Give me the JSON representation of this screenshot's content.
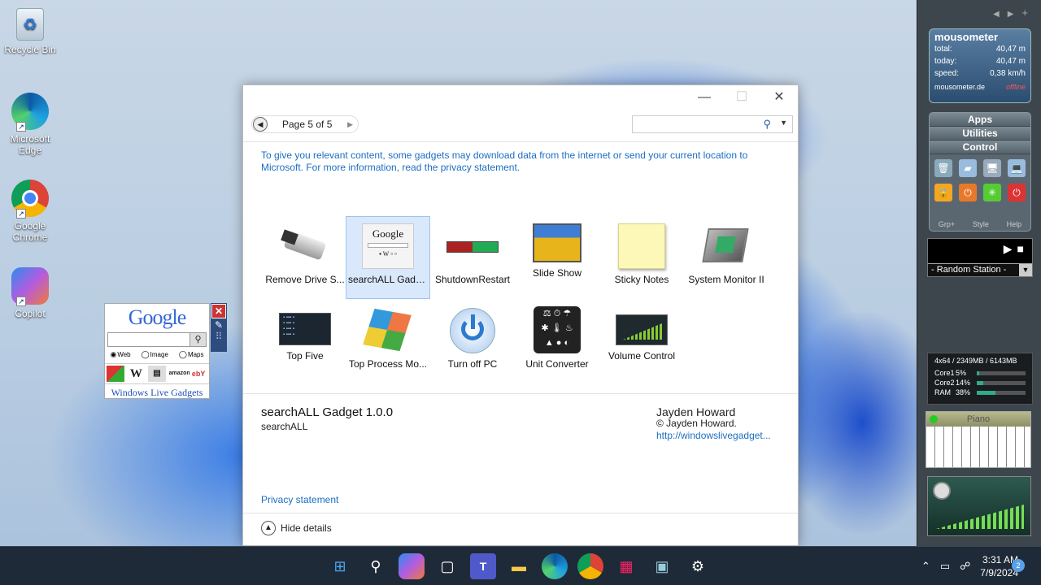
{
  "desktop": {
    "icons": [
      {
        "label": "Recycle Bin"
      },
      {
        "label": "Microsoft Edge"
      },
      {
        "label": "Google Chrome"
      },
      {
        "label": "Copilot"
      }
    ]
  },
  "google_gadget": {
    "logo": "Google",
    "radio_web": "Web",
    "radio_image": "Image",
    "radio_maps": "Maps",
    "link_wiki": "W",
    "link_amazon": "amazon",
    "link_ebay": "ebY",
    "footer": "Windows Live Gadgets"
  },
  "window": {
    "pager": {
      "label": "Page 5 of 5"
    },
    "search": {
      "placeholder": ""
    },
    "notice": "To give you relevant content, some gadgets may download data from the internet or send your current location to Microsoft. For more information, read the privacy statement.",
    "gadgets": [
      {
        "label": "Remove Drive S..."
      },
      {
        "label": "searchALL Gadg..."
      },
      {
        "label": "ShutdownRestart"
      },
      {
        "label": "Slide Show"
      },
      {
        "label": "Sticky Notes"
      },
      {
        "label": "System Monitor II"
      },
      {
        "label": "Top Five"
      },
      {
        "label": "Top Process Mo..."
      },
      {
        "label": "Turn off PC"
      },
      {
        "label": "Unit Converter"
      },
      {
        "label": "Volume Control"
      }
    ],
    "details": {
      "name": "searchALL Gadget 1.0.0",
      "subtitle": "searchALL",
      "author": "Jayden Howard",
      "copyright": "© Jayden Howard.",
      "link": "http://windowslivegadget..."
    },
    "privacy": "Privacy statement",
    "hide_details": "Hide details"
  },
  "sidebar": {
    "mousometer": {
      "title": "mousometer",
      "rows": [
        {
          "k": "total:",
          "v": "40,47 m"
        },
        {
          "k": "today:",
          "v": "40,47 m"
        },
        {
          "k": "speed:",
          "v": "0,38 km/h"
        }
      ],
      "site": "mousometer.de",
      "status": "offline"
    },
    "launcher": {
      "tabs": [
        "Apps",
        "Utilities",
        "Control"
      ],
      "footer": [
        "Grp+",
        "Style",
        "Help"
      ]
    },
    "radio": {
      "station": "- Random Station -"
    },
    "cpu": {
      "header": "4x64 / 2349MB / 6143MB",
      "rows": [
        {
          "n": "Core1",
          "p": "5%",
          "v": 0.05
        },
        {
          "n": "Core2",
          "p": "14%",
          "v": 0.14
        },
        {
          "n": "RAM",
          "p": "38%",
          "v": 0.38
        }
      ]
    },
    "piano": {
      "title": "Piano"
    }
  },
  "taskbar": {
    "time": "3:31 AM",
    "date": "7/9/2024",
    "notifications": "2"
  }
}
